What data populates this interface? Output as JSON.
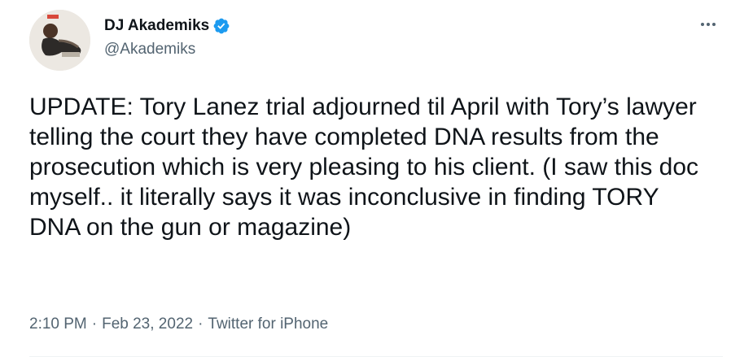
{
  "author": {
    "display_name": "DJ Akademiks",
    "handle": "@Akademiks",
    "verified": true,
    "avatar_icon": "profile-avatar"
  },
  "tweet": {
    "text": "UPDATE: Tory Lanez trial adjourned til April with Tory’s lawyer telling the court they have completed DNA results from the prosecution which is very pleasing to his client. (I saw this doc myself.. it literally says it was inconclusive in finding TORY DNA on the gun or magazine)"
  },
  "meta": {
    "time": "2:10 PM",
    "separator": "·",
    "date": "Feb 23, 2022",
    "source": "Twitter for iPhone"
  },
  "icons": {
    "more": "more-options-icon",
    "verified": "verified-badge-icon"
  },
  "colors": {
    "text_primary": "#0f1419",
    "text_secondary": "#536471",
    "verified_blue": "#1d9bf0",
    "divider": "#eff3f4"
  }
}
